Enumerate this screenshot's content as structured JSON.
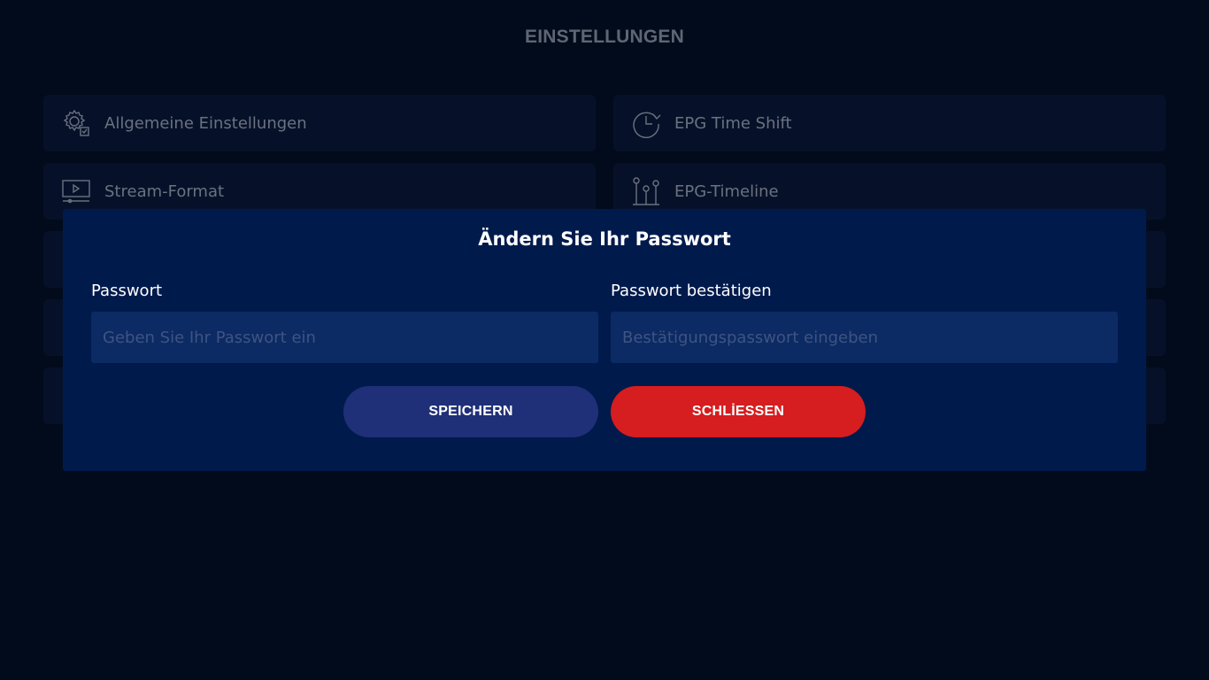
{
  "page": {
    "title": "EINSTELLUNGEN"
  },
  "settings": {
    "items": [
      {
        "label": "Allgemeine Einstellungen",
        "icon": "gear-icon"
      },
      {
        "label": "EPG Time Shift",
        "icon": "clock-icon"
      },
      {
        "label": "Stream-Format",
        "icon": "monitor-play-icon"
      },
      {
        "label": "EPG-Timeline",
        "icon": "timeline-icon"
      }
    ]
  },
  "dialog": {
    "title": "Ändern Sie Ihr Passwort",
    "password_label": "Passwort",
    "password_placeholder": "Geben Sie Ihr Passwort ein",
    "confirm_label": "Passwort bestätigen",
    "confirm_placeholder": "Bestätigungspasswort eingeben",
    "save_label": "SPEICHERN",
    "close_label": "SCHLİESSEN"
  },
  "colors": {
    "background": "#010b1c",
    "modal": "#001a4c",
    "input": "#0c2a63",
    "save": "#1f2f78",
    "close": "#d61d1f"
  }
}
